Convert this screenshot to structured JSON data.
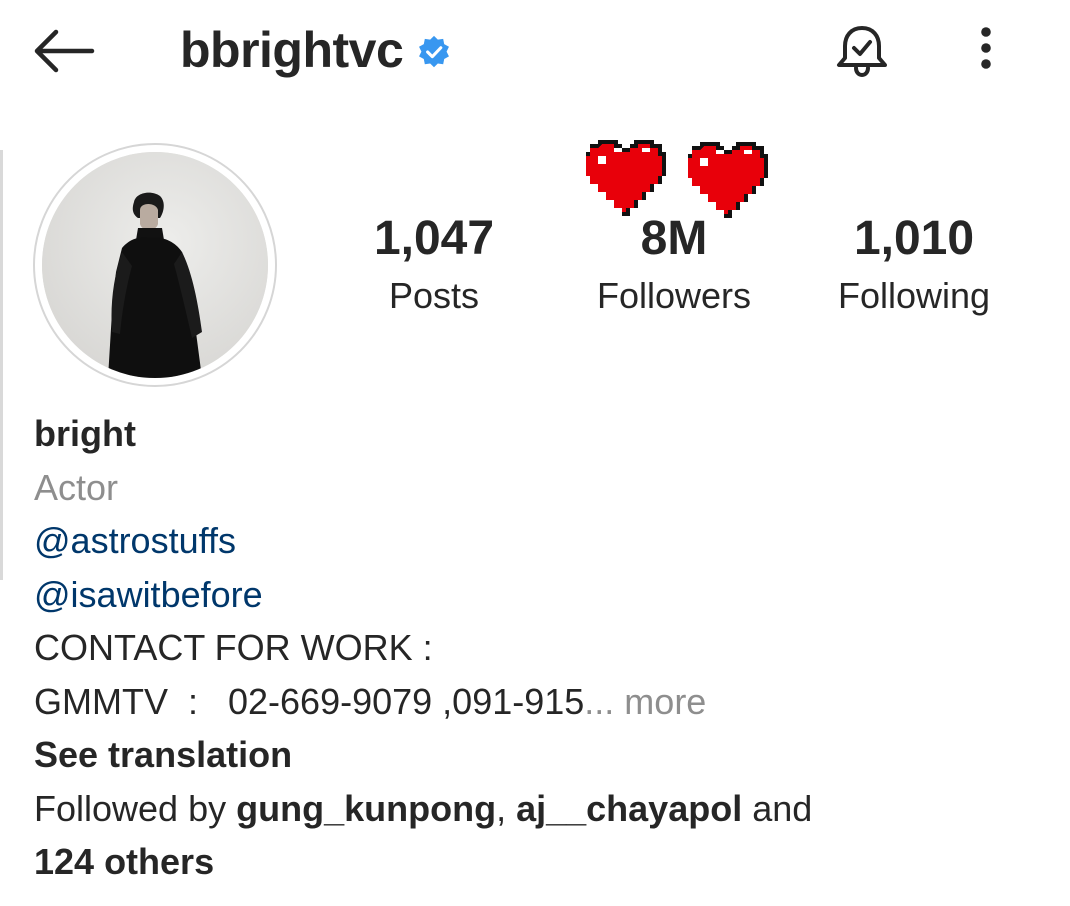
{
  "header": {
    "username": "bbrightvc",
    "verified_color": "#3897f0",
    "icons": [
      "back-arrow-icon",
      "verified-badge-icon",
      "bell-check-icon",
      "more-vertical-icon"
    ]
  },
  "stats": {
    "posts": {
      "value": "1,047",
      "label": "Posts"
    },
    "followers": {
      "value": "8M",
      "label": "Followers"
    },
    "following": {
      "value": "1,010",
      "label": "Following"
    }
  },
  "decorations": {
    "heart_color": "#e8000a",
    "heart_count": 2
  },
  "bio": {
    "name": "bright",
    "category": "Actor",
    "links": [
      "@astrostuffs",
      "@isawitbefore"
    ],
    "contact_line": "CONTACT FOR WORK :",
    "phone_line": "GMMTV  :   02-669-9079 ,091-915",
    "more": "... more",
    "see_translation": "See translation",
    "followed_by_prefix": "Followed by ",
    "followed_user_1": "gung_kunpong",
    "comma": ", ",
    "followed_user_2": "aj__chayapol",
    "and_text": " and",
    "others": "124 others"
  },
  "colors": {
    "text": "#262626",
    "secondary": "#8e8e8e",
    "link": "#00376b"
  }
}
